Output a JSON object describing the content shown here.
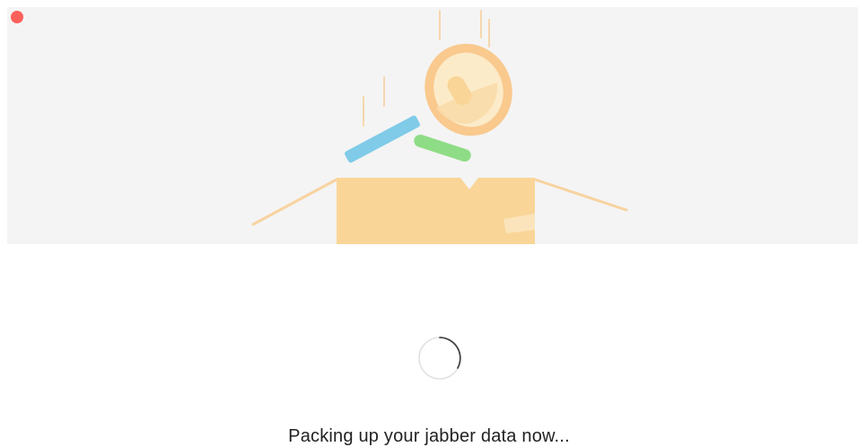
{
  "window": {
    "close_button": "close"
  },
  "illustration": {
    "icon": "packing-box-illustration",
    "colors": {
      "background": "#f4f4f4",
      "box": "#fad598",
      "box_flap_line": "#f8d3a0",
      "coin": "#f9c98e",
      "blue_stick": "#7fcbe8",
      "green_stick": "#8fdc86"
    }
  },
  "progress": {
    "icon": "loading-spinner-icon",
    "state": "indeterminate"
  },
  "status": {
    "message": "Packing up your jabber data now..."
  },
  "colors": {
    "close_button": "#fc605b",
    "text": "#222222"
  }
}
